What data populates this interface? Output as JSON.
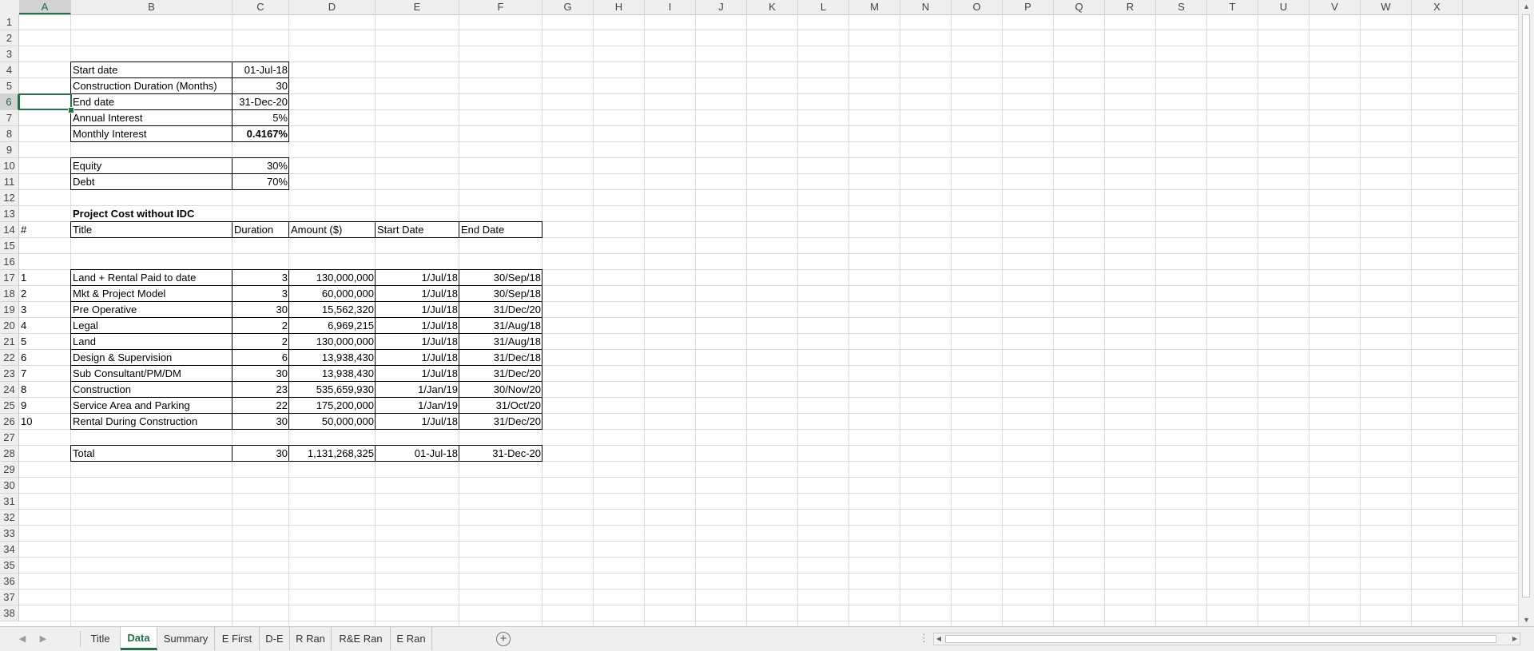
{
  "columns": [
    "A",
    "B",
    "C",
    "D",
    "E",
    "F",
    "G",
    "H",
    "I",
    "J",
    "K",
    "L",
    "M",
    "N",
    "O",
    "P",
    "Q",
    "R",
    "S",
    "T",
    "U",
    "V",
    "W",
    "X"
  ],
  "rows": [
    "1",
    "2",
    "3",
    "4",
    "5",
    "6",
    "7",
    "8",
    "9",
    "10",
    "11",
    "12",
    "13",
    "14",
    "15",
    "16",
    "17",
    "18",
    "19",
    "20",
    "21",
    "22",
    "23",
    "24",
    "25",
    "26",
    "27",
    "28",
    "29",
    "30",
    "31",
    "32",
    "33",
    "34",
    "35",
    "36",
    "37",
    "38"
  ],
  "selected_cell": "A6",
  "params": [
    {
      "label": "Start date",
      "value": "01-Jul-18"
    },
    {
      "label": "Construction Duration (Months)",
      "value": "30"
    },
    {
      "label": "End date",
      "value": "31-Dec-20"
    },
    {
      "label": "Annual Interest",
      "value": "5%"
    },
    {
      "label": "Monthly Interest",
      "value": "0.4167%"
    }
  ],
  "financing": [
    {
      "label": "Equity",
      "value": "30%"
    },
    {
      "label": "Debt",
      "value": "70%"
    }
  ],
  "project_title": "Project Cost without IDC",
  "table_headers": {
    "num": "#",
    "title": "Title",
    "duration": "Duration",
    "amount": "Amount ($)",
    "start": "Start Date",
    "end": "End Date"
  },
  "table_rows": [
    {
      "num": "1",
      "title": "Land + Rental Paid to date",
      "duration": "3",
      "amount": "130,000,000",
      "start": "1/Jul/18",
      "end": "30/Sep/18"
    },
    {
      "num": "2",
      "title": "Mkt & Project Model",
      "duration": "3",
      "amount": "60,000,000",
      "start": "1/Jul/18",
      "end": "30/Sep/18"
    },
    {
      "num": "3",
      "title": "Pre Operative",
      "duration": "30",
      "amount": "15,562,320",
      "start": "1/Jul/18",
      "end": "31/Dec/20"
    },
    {
      "num": "4",
      "title": "Legal",
      "duration": "2",
      "amount": "6,969,215",
      "start": "1/Jul/18",
      "end": "31/Aug/18"
    },
    {
      "num": "5",
      "title": " Land",
      "duration": "2",
      "amount": "130,000,000",
      "start": "1/Jul/18",
      "end": "31/Aug/18"
    },
    {
      "num": "6",
      "title": "Design & Supervision",
      "duration": "6",
      "amount": "13,938,430",
      "start": "1/Jul/18",
      "end": "31/Dec/18"
    },
    {
      "num": "7",
      "title": "Sub Consultant/PM/DM",
      "duration": "30",
      "amount": "13,938,430",
      "start": "1/Jul/18",
      "end": "31/Dec/20"
    },
    {
      "num": "8",
      "title": "Construction",
      "duration": "23",
      "amount": "535,659,930",
      "start": "1/Jan/19",
      "end": "30/Nov/20"
    },
    {
      "num": "9",
      "title": " Service Area and Parking",
      "duration": "22",
      "amount": "175,200,000",
      "start": "1/Jan/19",
      "end": "31/Oct/20"
    },
    {
      "num": "10",
      "title": "Rental During Construction",
      "duration": "30",
      "amount": "50,000,000",
      "start": "1/Jul/18",
      "end": "31/Dec/20"
    }
  ],
  "total": {
    "label": "Total",
    "duration": "30",
    "amount": "1,131,268,325",
    "start": "01-Jul-18",
    "end": "31-Dec-20"
  },
  "sheet_tabs": [
    "Title",
    "Data",
    "Summary",
    "E First",
    "D-E",
    "R Ran",
    "R&E Ran",
    "E Ran"
  ],
  "active_tab": "Data",
  "icons": {
    "add_sheet": "+",
    "prev": "◀",
    "next": "▶",
    "more": "⋮"
  },
  "colors": {
    "accent": "#217346"
  }
}
